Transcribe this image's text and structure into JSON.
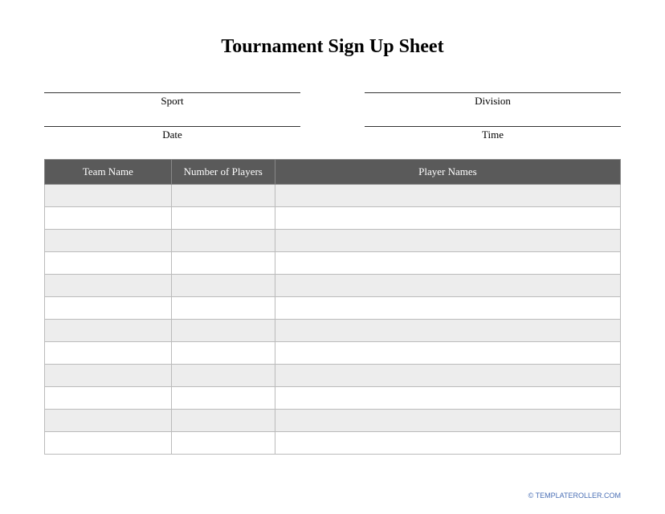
{
  "title": "Tournament Sign Up Sheet",
  "fields": {
    "row1": {
      "left": "Sport",
      "right": "Division"
    },
    "row2": {
      "left": "Date",
      "right": "Time"
    }
  },
  "table": {
    "headers": [
      "Team Name",
      "Number of Players",
      "Player Names"
    ],
    "rows": [
      {
        "team": "",
        "count": "",
        "players": ""
      },
      {
        "team": "",
        "count": "",
        "players": ""
      },
      {
        "team": "",
        "count": "",
        "players": ""
      },
      {
        "team": "",
        "count": "",
        "players": ""
      },
      {
        "team": "",
        "count": "",
        "players": ""
      },
      {
        "team": "",
        "count": "",
        "players": ""
      },
      {
        "team": "",
        "count": "",
        "players": ""
      },
      {
        "team": "",
        "count": "",
        "players": ""
      },
      {
        "team": "",
        "count": "",
        "players": ""
      },
      {
        "team": "",
        "count": "",
        "players": ""
      },
      {
        "team": "",
        "count": "",
        "players": ""
      },
      {
        "team": "",
        "count": "",
        "players": ""
      }
    ]
  },
  "footer": "© TEMPLATEROLLER.COM"
}
